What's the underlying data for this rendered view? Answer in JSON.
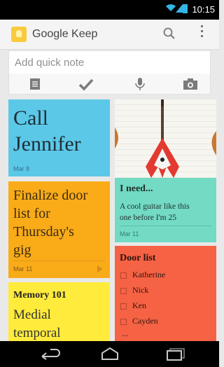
{
  "status_bar": {
    "time": "10:15"
  },
  "app_bar": {
    "title": "Google Keep",
    "icons": [
      "search-icon",
      "overflow-icon"
    ]
  },
  "quick_note": {
    "placeholder": "Add quick note",
    "tools": [
      "list-icon",
      "checkmark-icon",
      "microphone-icon",
      "camera-icon"
    ]
  },
  "notes": {
    "call": {
      "lines": [
        "Call",
        "Jennifer"
      ],
      "date": "Mar 8",
      "color": "#5bc8e8"
    },
    "finalize": {
      "lines": [
        "Finalize door",
        "list for",
        "Thursday's",
        "gig"
      ],
      "date": "Mar 11",
      "color": "#f9ab18"
    },
    "memory": {
      "title": "Memory 101",
      "lines": [
        "Medial",
        "temporal"
      ],
      "color": "#ffeb3b"
    },
    "guitar": {
      "title": "I need...",
      "lines": [
        "A cool guitar like this",
        "one before I'm 25"
      ],
      "date": "Mar 11",
      "color": "#73dac4"
    },
    "door": {
      "title": "Door list",
      "items": [
        "Katherine",
        "Nick",
        "Ken",
        "Cayden"
      ],
      "more": "...",
      "color": "#f66244"
    }
  },
  "nav_bar": {
    "buttons": [
      "back-icon",
      "home-icon",
      "recent-apps-icon"
    ]
  }
}
